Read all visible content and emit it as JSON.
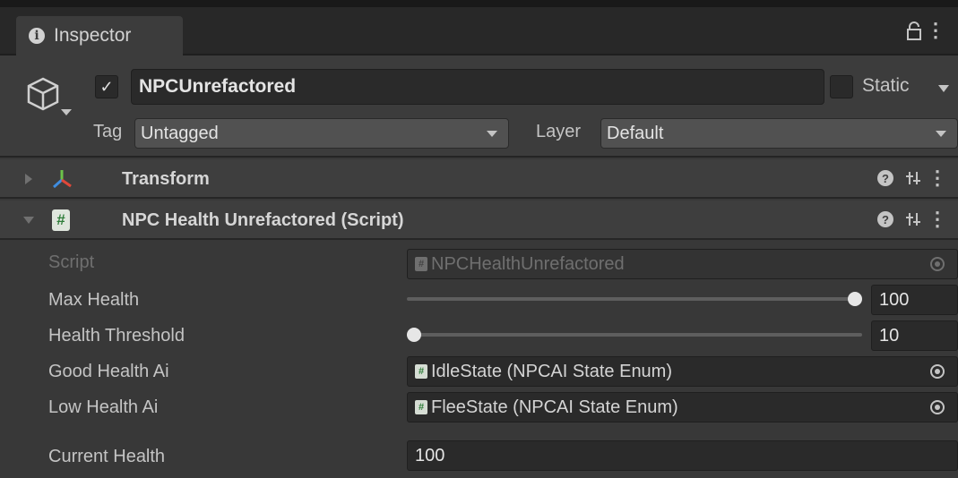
{
  "tab": {
    "title": "Inspector"
  },
  "object": {
    "name": "NPCUnrefactored",
    "active": true,
    "static_label": "Static",
    "static": false,
    "tag_label": "Tag",
    "tag_value": "Untagged",
    "layer_label": "Layer",
    "layer_value": "Default"
  },
  "components": [
    {
      "title": "Transform",
      "expanded": false
    },
    {
      "title": "NPC Health Unrefactored (Script)",
      "expanded": true
    }
  ],
  "script_fields": {
    "script": {
      "label": "Script",
      "value": "NPCHealthUnrefactored"
    },
    "max_health": {
      "label": "Max Health",
      "value": "100",
      "slider_fraction": 1.0
    },
    "health_threshold": {
      "label": "Health Threshold",
      "value": "10",
      "slider_fraction": 0.0
    },
    "good_health_ai": {
      "label": "Good Health Ai",
      "value": "IdleState (NPCAI State Enum)"
    },
    "low_health_ai": {
      "label": "Low Health Ai",
      "value": "FleeState (NPCAI State Enum)"
    },
    "current_health": {
      "label": "Current Health",
      "value": "100"
    }
  },
  "icons": {
    "tab": "info-icon",
    "lock": "lock-icon",
    "menu": "kebab-menu-icon",
    "object": "cube-icon",
    "transform": "transform-axes-icon",
    "script": "csharp-script-icon",
    "help": "help-icon",
    "presets": "presets-icon",
    "object_picker": "object-picker-icon"
  },
  "colors": {
    "background": "#383838",
    "field": "#2a2a2a",
    "text": "#c4c4c4",
    "axis_red": "#e0483a",
    "axis_green": "#6cc24a",
    "axis_blue": "#3f8de0"
  }
}
